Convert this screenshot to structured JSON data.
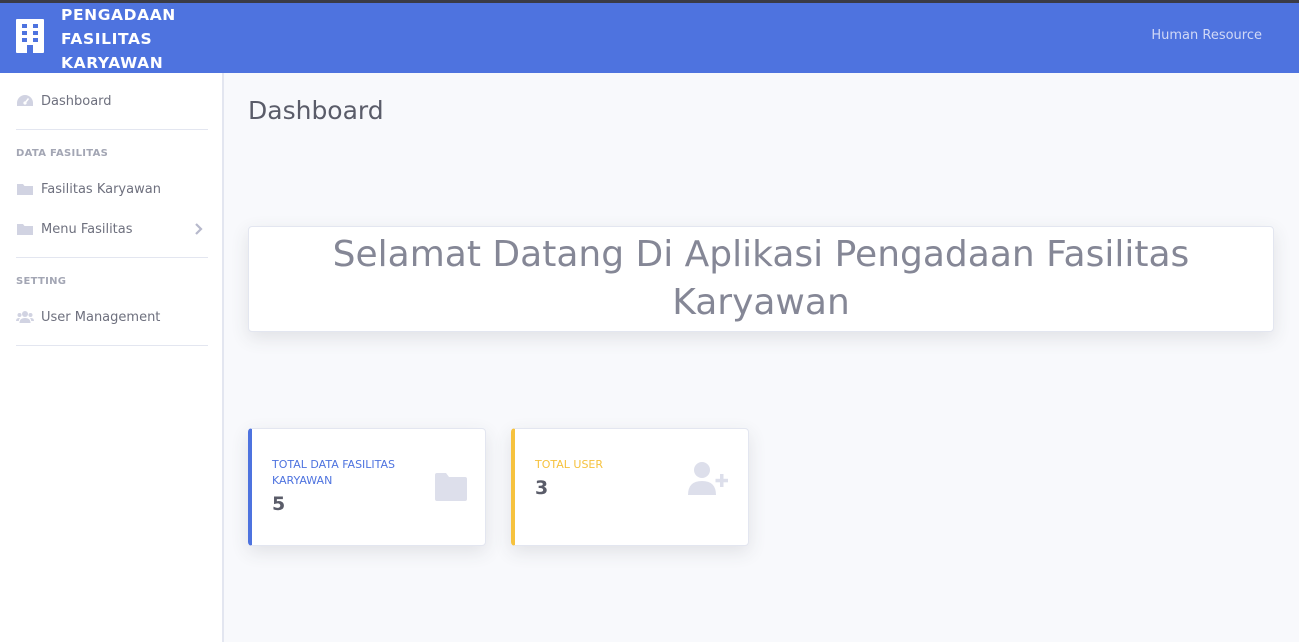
{
  "brand": {
    "title": "PENGADAAN FASILITAS KARYAWAN",
    "icon": "building-icon"
  },
  "topbar": {
    "user": "Human Resource"
  },
  "sidebar": {
    "dashboard": {
      "label": "Dashboard",
      "icon": "tachometer-icon"
    },
    "section1": "DATA FASILITAS",
    "fasilitas_karyawan": {
      "label": "Fasilitas Karyawan",
      "icon": "folder-icon"
    },
    "menu_fasilitas": {
      "label": "Menu Fasilitas",
      "icon": "folder-icon"
    },
    "section2": "SETTING",
    "user_management": {
      "label": "User Management",
      "icon": "users-icon"
    }
  },
  "main": {
    "title": "Dashboard",
    "welcome": "Selamat Datang Di Aplikasi Pengadaan Fasilitas Karyawan",
    "cards": [
      {
        "label": "TOTAL DATA FASILITAS KARYAWAN",
        "value": "5",
        "icon": "folder-icon",
        "color": "#4e73df"
      },
      {
        "label": "TOTAL USER",
        "value": "3",
        "icon": "user-plus-icon",
        "color": "#f6c23e"
      }
    ]
  },
  "colors": {
    "primary": "#4e73df",
    "warning": "#f6c23e",
    "background": "#f8f9fc"
  }
}
